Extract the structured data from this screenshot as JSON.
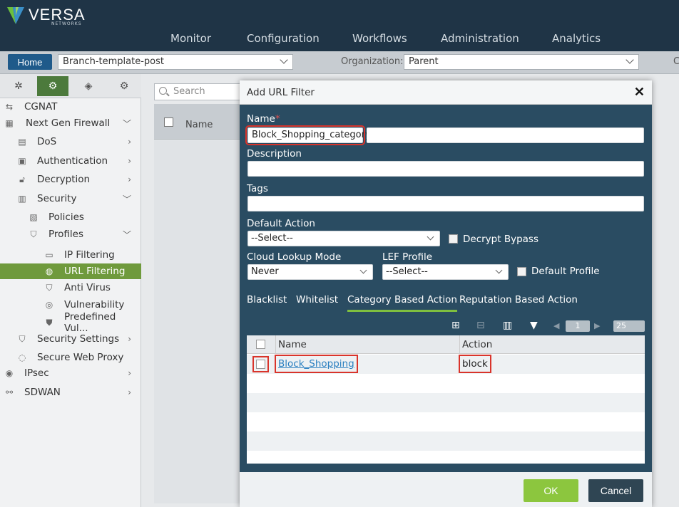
{
  "brand": {
    "name": "VERSA",
    "sub": "NETWORKS"
  },
  "nav": [
    "Monitor",
    "Configuration",
    "Workflows",
    "Administration",
    "Analytics"
  ],
  "subbar": {
    "home": "Home",
    "template": "Branch-template-post",
    "org_label": "Organization:",
    "org_value": "Parent",
    "cut": "C"
  },
  "sidebar": {
    "items": [
      {
        "label": "CGNAT",
        "icon": "cgnat-icon"
      },
      {
        "label": "Next Gen Firewall",
        "icon": "firewall-icon"
      },
      {
        "label": "DoS",
        "icon": "dos-icon"
      },
      {
        "label": "Authentication",
        "icon": "authentication-icon"
      },
      {
        "label": "Decryption",
        "icon": "decryption-icon"
      },
      {
        "label": "Security",
        "icon": "security-icon"
      },
      {
        "label": "Policies",
        "icon": "policies-icon"
      },
      {
        "label": "Profiles",
        "icon": "profiles-icon"
      },
      {
        "label": "IP Filtering",
        "icon": "ip-filtering-icon"
      },
      {
        "label": "URL Filtering",
        "icon": "url-filtering-icon"
      },
      {
        "label": "Anti Virus",
        "icon": "antivirus-icon"
      },
      {
        "label": "Vulnerability",
        "icon": "vulnerability-icon"
      },
      {
        "label": "Predefined Vul...",
        "icon": "predefined-vul-icon"
      },
      {
        "label": "Security Settings",
        "icon": "security-settings-icon"
      },
      {
        "label": "Secure Web Proxy",
        "icon": "secure-web-proxy-icon"
      },
      {
        "label": "IPsec",
        "icon": "ipsec-icon"
      },
      {
        "label": "SDWAN",
        "icon": "sdwan-icon"
      }
    ]
  },
  "content": {
    "search_placeholder": "Search",
    "col_name": "Name"
  },
  "modal": {
    "title": "Add URL Filter",
    "name_label": "Name",
    "name_value": "Block_Shopping_category",
    "description_label": "Description",
    "tags_label": "Tags",
    "default_action_label": "Default Action",
    "default_action_value": "--Select--",
    "decrypt_bypass_label": "Decrypt Bypass",
    "cloud_lookup_label": "Cloud Lookup Mode",
    "cloud_lookup_value": "Never",
    "lef_profile_label": "LEF Profile",
    "lef_profile_value": "--Select--",
    "default_profile_label": "Default Profile",
    "tabs": [
      "Blacklist",
      "Whitelist",
      "Category Based Action",
      "Reputation Based Action"
    ],
    "page_number": "1",
    "page_size": "25",
    "table": {
      "headers": [
        "Name",
        "Action"
      ],
      "rows": [
        {
          "name": "Block_Shopping",
          "action": "block"
        }
      ]
    },
    "ok_label": "OK",
    "cancel_label": "Cancel"
  },
  "colors": {
    "accent_green": "#8cc63e",
    "selected_tree": "#6f9a3c",
    "modal_bg": "#2a4c62",
    "topbar": "#1f3446",
    "highlight": "#d9342b"
  }
}
